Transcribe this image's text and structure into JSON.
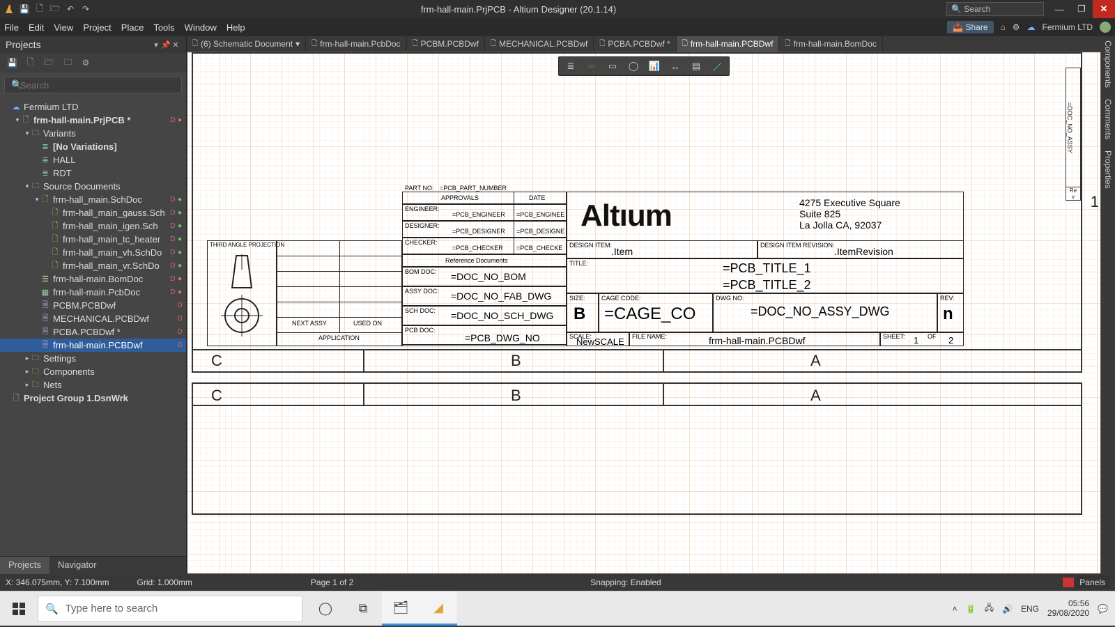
{
  "app": {
    "title": "frm-hall-main.PrjPCB - Altium Designer (20.1.14)",
    "search_placeholder": "Search",
    "share_label": "Share",
    "org_label": "Fermium LTD"
  },
  "menus": [
    "File",
    "Edit",
    "View",
    "Project",
    "Place",
    "Tools",
    "Window",
    "Help"
  ],
  "projects": {
    "title": "Projects",
    "search_placeholder": "Search",
    "tabs": [
      "Projects",
      "Navigator"
    ],
    "tree": [
      {
        "depth": 0,
        "caret": "",
        "icon": "ic-cloud",
        "label": "Fermium LTD"
      },
      {
        "depth": 1,
        "caret": "▾",
        "icon": "ic-file",
        "label": "frm-hall-main.PrjPCB *",
        "bold": true,
        "stat": "D",
        "dot": "red"
      },
      {
        "depth": 2,
        "caret": "▾",
        "icon": "ic-folder",
        "label": "Variants"
      },
      {
        "depth": 3,
        "caret": "",
        "icon": "ic-variant",
        "label": "[No Variations]",
        "bold": true
      },
      {
        "depth": 3,
        "caret": "",
        "icon": "ic-variant",
        "label": "HALL"
      },
      {
        "depth": 3,
        "caret": "",
        "icon": "ic-variant",
        "label": "RDT"
      },
      {
        "depth": 2,
        "caret": "▾",
        "icon": "ic-folder",
        "label": "Source Documents"
      },
      {
        "depth": 3,
        "caret": "▾",
        "icon": "ic-file",
        "label": "frm-hall_main.SchDoc",
        "stat": "D",
        "dot": "green"
      },
      {
        "depth": 4,
        "caret": "",
        "icon": "ic-file",
        "label": "frm-hall_main_gauss.Sch",
        "stat": "D",
        "dot": "green"
      },
      {
        "depth": 4,
        "caret": "",
        "icon": "ic-file",
        "label": "frm-hall_main_igen.Sch",
        "stat": "D",
        "dot": "green"
      },
      {
        "depth": 4,
        "caret": "",
        "icon": "ic-file",
        "label": "frm-hall_main_tc_heater",
        "stat": "D",
        "dot": "green"
      },
      {
        "depth": 4,
        "caret": "",
        "icon": "ic-file",
        "label": "frm-hall_main_vh.SchDo",
        "stat": "D",
        "dot": "green"
      },
      {
        "depth": 4,
        "caret": "",
        "icon": "ic-file",
        "label": "frm-hall_main_vr.SchDo",
        "stat": "D",
        "dot": "green"
      },
      {
        "depth": 3,
        "caret": "",
        "icon": "ic-bom",
        "label": "frm-hall-main.BomDoc",
        "stat": "D",
        "dot": "red"
      },
      {
        "depth": 3,
        "caret": "",
        "icon": "ic-pcb",
        "label": "frm-hall-main.PcbDoc",
        "stat": "D",
        "dot": "red"
      },
      {
        "depth": 3,
        "caret": "",
        "icon": "ic-draft",
        "label": "PCBM.PCBDwf",
        "stat": "D"
      },
      {
        "depth": 3,
        "caret": "",
        "icon": "ic-draft",
        "label": "MECHANICAL.PCBDwf",
        "stat": "D"
      },
      {
        "depth": 3,
        "caret": "",
        "icon": "ic-draft",
        "label": "PCBA.PCBDwf *",
        "stat": "D"
      },
      {
        "depth": 3,
        "caret": "",
        "icon": "ic-draft",
        "label": "frm-hall-main.PCBDwf",
        "stat": "D",
        "selected": true
      },
      {
        "depth": 2,
        "caret": "▸",
        "icon": "ic-folder",
        "label": "Settings"
      },
      {
        "depth": 2,
        "caret": "▸",
        "icon": "ic-folder",
        "label": "Components"
      },
      {
        "depth": 2,
        "caret": "▸",
        "icon": "ic-folder",
        "label": "Nets"
      },
      {
        "depth": 0,
        "caret": "",
        "icon": "ic-file",
        "label": "Project Group 1.DsnWrk",
        "bold": true
      }
    ]
  },
  "doctabs": [
    {
      "label": "(6) Schematic Document",
      "drop": true
    },
    {
      "label": "frm-hall-main.PcbDoc"
    },
    {
      "label": "PCBM.PCBDwf"
    },
    {
      "label": "MECHANICAL.PCBDwf"
    },
    {
      "label": "PCBA.PCBDwf *"
    },
    {
      "label": "frm-hall-main.PCBDwf",
      "active": true
    },
    {
      "label": "frm-hall-main.BomDoc"
    }
  ],
  "rightdock": [
    "Components",
    "Comments",
    "Properties"
  ],
  "titleblock": {
    "projection": "THIRD ANGLE PROJECTION",
    "partno_lbl": "PART NO:",
    "partno_val": "=PCB_PART_NUMBER",
    "approvals": "APPROVALS",
    "date": "DATE",
    "engineer_lbl": "ENGINEER:",
    "engineer_val": "=PCB_ENGINEER",
    "engineer_date": "=PCB_ENGINEE",
    "designer_lbl": "DESIGNER:",
    "designer_val": "=PCB_DESIGNER",
    "designer_date": "=PCB_DESIGNE",
    "checker_lbl": "CHECKER:",
    "checker_val": "=PCB_CHECKER",
    "checker_date": "=PCB_CHECKE",
    "refdocs": "Reference Documents",
    "bomdoc_lbl": "BOM DOC:",
    "bomdoc_val": "=DOC_NO_BOM",
    "assydoc_lbl": "ASSY DOC:",
    "assydoc_val": "=DOC_NO_FAB_DWG",
    "schdoc_lbl": "SCH DOC:",
    "schdoc_val": "=DOC_NO_SCH_DWG",
    "pcbdoc_lbl": "PCB DOC:",
    "pcbdoc_val": "=PCB_DWG_NO",
    "nextassy": "NEXT ASSY",
    "usedon": "USED ON",
    "application": "APPLICATION",
    "logo": "Altıum",
    "addr1": "4275 Executive Square",
    "addr2": "Suite 825",
    "addr3": "La Jolla CA, 92037",
    "designitem_lbl": "DESIGN ITEM:",
    "designitem_val": ".Item",
    "designitemrev_lbl": "DESIGN ITEM REVISION:",
    "designitemrev_val": ".ItemRevision",
    "title_lbl": "TITLE:",
    "title1": "=PCB_TITLE_1",
    "title2": "=PCB_TITLE_2",
    "size_lbl": "SIZE:",
    "size_val": "B",
    "cage_lbl": "CAGE CODE:",
    "cage_val": "=CAGE_CO",
    "dwgno_lbl": "DWG NO:",
    "dwgno_val": "=DOC_NO_ASSY_DWG",
    "rev_lbl": "REV:",
    "rev_val": "n",
    "scale_lbl": "SCALE:",
    "scale_val": "NewSCALE",
    "filename_lbl": "FILE NAME:",
    "filename_val": "frm-hall-main.PCBDwf",
    "sheet_lbl": "SHEET:",
    "sheet_cur": "1",
    "sheet_of_lbl": "OF",
    "sheet_tot": "2",
    "zone_c": "C",
    "zone_b": "B",
    "zone_a": "A",
    "revstrip": "=DOC_NO_ASSY",
    "edge1": "1"
  },
  "statusbar": {
    "coords": "X: 346.075mm, Y: 7.100mm",
    "grid": "Grid: 1.000mm",
    "page": "Page 1 of 2",
    "snap": "Snapping: Enabled",
    "panels": "Panels"
  },
  "taskbar": {
    "search_placeholder": "Type here to search",
    "lang": "ENG",
    "time": "05:56",
    "date": "29/08/2020"
  }
}
